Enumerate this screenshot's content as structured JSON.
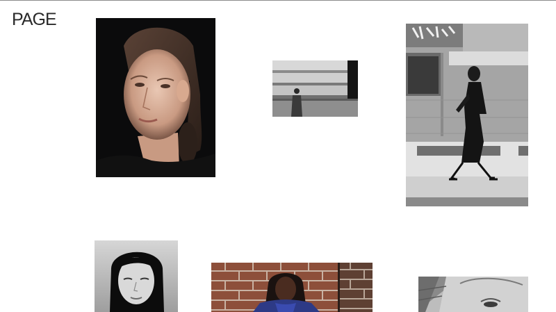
{
  "site": {
    "logo_text": "PAGE"
  },
  "gallery": {
    "photos": [
      {
        "id": "portrait-dark-hair-pulled-back",
        "tone": "color"
      },
      {
        "id": "architecture-figure-bw",
        "tone": "monochrome"
      },
      {
        "id": "street-walking-woman-bw",
        "tone": "monochrome"
      },
      {
        "id": "portrait-long-black-hair-bw",
        "tone": "monochrome"
      },
      {
        "id": "brick-wall-portrait-blue-jacket",
        "tone": "color"
      },
      {
        "id": "closeup-face-bw",
        "tone": "monochrome"
      }
    ]
  }
}
